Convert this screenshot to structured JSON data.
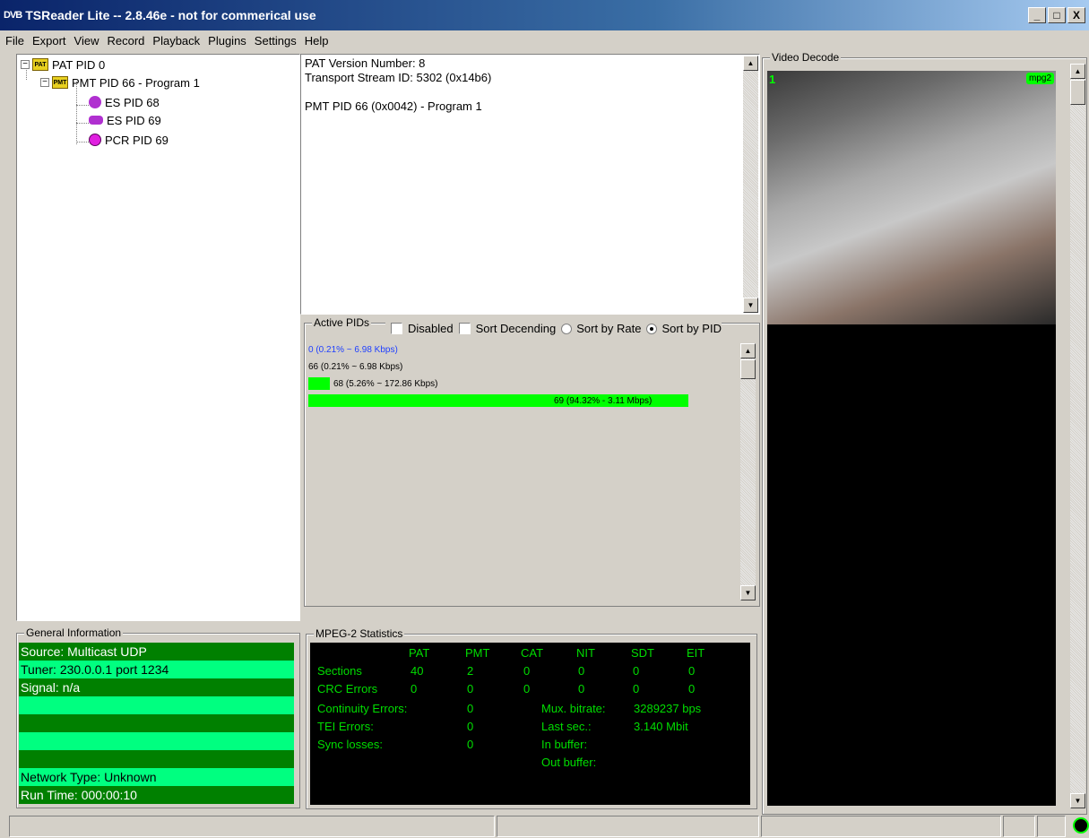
{
  "window": {
    "logo": "DVB",
    "title": "TSReader Lite -- 2.8.46e - not for commerical use",
    "minimize": "_",
    "maximize": "□",
    "close": "X"
  },
  "menu": [
    "File",
    "Export",
    "View",
    "Record",
    "Playback",
    "Plugins",
    "Settings",
    "Help"
  ],
  "tree": {
    "pat": "PAT PID 0",
    "pmt": "PMT PID 66 - Program 1",
    "es1": "ES PID 68",
    "es2": "ES PID 69",
    "pcr": "PCR PID 69"
  },
  "info": {
    "line1": "PAT Version Number: 8",
    "line2": "Transport Stream ID: 5302 (0x14b6)",
    "line3": "PMT PID 66 (0x0042) - Program 1"
  },
  "active_pids": {
    "label": "Active PIDs",
    "disabled": "Disabled",
    "sort_descending": "Sort Decending",
    "sort_rate": "Sort by Rate",
    "sort_pid": "Sort by PID",
    "rows": [
      {
        "text": "0 (0.21% ~ 6.98 Kbps)",
        "fraction": 0.0021
      },
      {
        "text": "66 (0.21% ~ 6.98 Kbps)",
        "fraction": 0.0021
      },
      {
        "text": "68 (5.26% ~ 172.86 Kbps)",
        "fraction": 0.0526
      },
      {
        "text": "69 (94.32% - 3.11 Mbps)",
        "fraction": 0.9432
      }
    ]
  },
  "general": {
    "label": "General Information",
    "source": "Source: Multicast UDP",
    "tuner": "Tuner: 230.0.0.1 port 1234",
    "signal": "Signal: n/a",
    "network": "Network Type: Unknown",
    "runtime": "Run Time: 000:00:10"
  },
  "stats": {
    "label": "MPEG-2 Statistics",
    "headers": [
      "PAT",
      "PMT",
      "CAT",
      "NIT",
      "SDT",
      "EIT"
    ],
    "sections_label": "Sections",
    "sections": [
      "40",
      "2",
      "0",
      "0",
      "0",
      "0"
    ],
    "crc_label": "CRC Errors",
    "crc": [
      "0",
      "0",
      "0",
      "0",
      "0",
      "0"
    ],
    "continuity_label": "Continuity Errors:",
    "continuity": "0",
    "tei_label": "TEI Errors:",
    "tei": "0",
    "sync_label": "Sync losses:",
    "sync": "0",
    "mux_label": "Mux. bitrate:",
    "mux": "3289237 bps",
    "lastsec_label": "Last sec.:",
    "lastsec": "3.140 Mbit",
    "inbuf_label": "In buffer:",
    "outbuf_label": "Out buffer:"
  },
  "video": {
    "label": "Video Decode",
    "number": "1",
    "codec": "mpg2"
  },
  "colors": {
    "accent_green": "#00ff00",
    "dark_green": "#008000",
    "light_green": "#00ff80",
    "stat_text": "#00dd00"
  }
}
